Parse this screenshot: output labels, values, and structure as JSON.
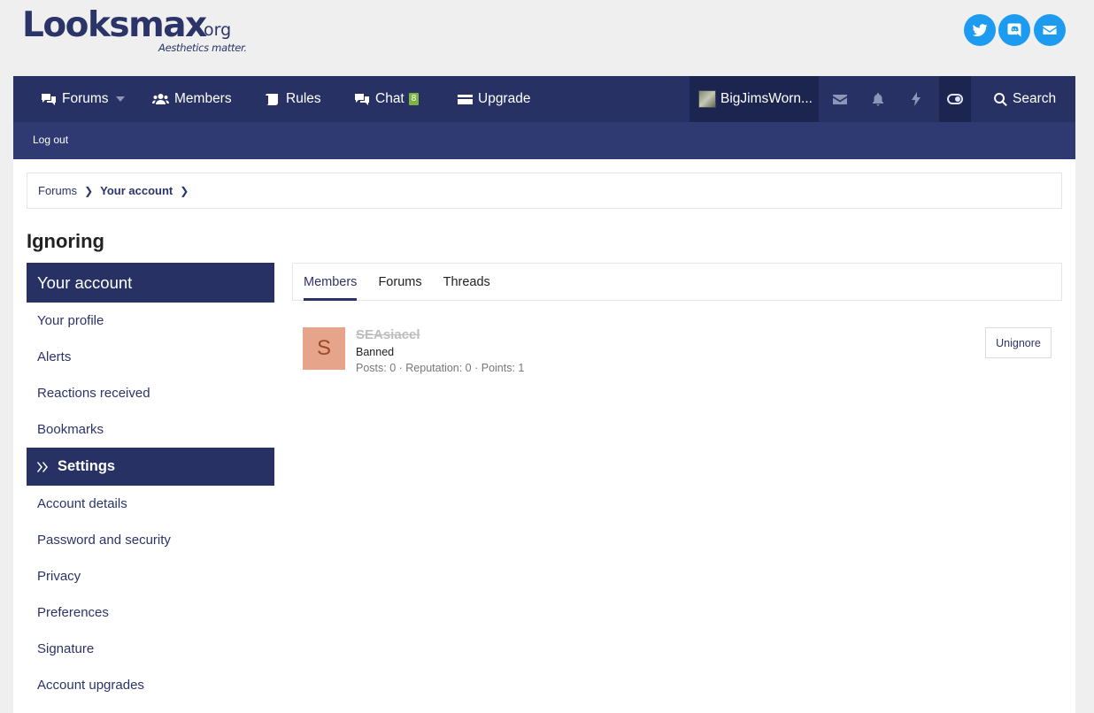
{
  "logo": {
    "text_looks": "Looks",
    "text_max": "max",
    "text_org": ".org",
    "tagline": "Aesthetics matter."
  },
  "social": [
    {
      "name": "twitter-icon",
      "color": "#1d9bf0"
    },
    {
      "name": "discord-icon",
      "color": "#1d9bf0"
    },
    {
      "name": "mail-icon",
      "color": "#1d9bf0"
    }
  ],
  "nav": {
    "forums": "Forums",
    "members": "Members",
    "rules": "Rules",
    "chat": "Chat",
    "chat_badge": "8",
    "upgrade": "Upgrade",
    "username": "BigJimsWorn...",
    "search": "Search"
  },
  "subnav": {
    "logout": "Log out"
  },
  "breadcrumb": {
    "forums": "Forums",
    "account": "Your account"
  },
  "page_title": "Ignoring",
  "sidebar": {
    "head": "Your account",
    "links_top": [
      "Your profile",
      "Alerts",
      "Reactions received",
      "Bookmarks"
    ],
    "settings": "Settings",
    "links_bottom": [
      "Account details",
      "Password and security",
      "Privacy",
      "Preferences",
      "Signature",
      "Account upgrades"
    ]
  },
  "tabs": [
    "Members",
    "Forums",
    "Threads"
  ],
  "member": {
    "initial": "S",
    "name": "SEAsiacel",
    "title": "Banned",
    "stats": "Posts: 0 · Reputation: 0 · Points: 1",
    "action": "Unignore"
  },
  "colors": {
    "navbar": "#283163",
    "accent": "#2b3468",
    "badge": "#7cb342",
    "avatar_bg": "#e6a58a"
  }
}
